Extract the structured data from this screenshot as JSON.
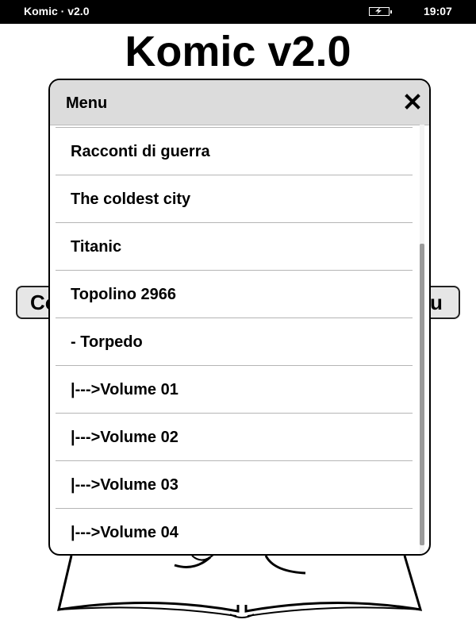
{
  "status_bar": {
    "title": "Komic · v2.0",
    "time": "19:07",
    "icons": {
      "battery": "battery-charging-icon"
    }
  },
  "app": {
    "title": "Komic v2.0"
  },
  "background_buttons": {
    "left_label": "Co",
    "right_label": "u"
  },
  "menu": {
    "title": "Menu",
    "close_icon": "close-icon",
    "items": [
      {
        "label": "Racconti di guerra"
      },
      {
        "label": "The coldest city"
      },
      {
        "label": "Titanic"
      },
      {
        "label": "Topolino 2966"
      },
      {
        "label": "- Torpedo"
      },
      {
        "label": "|--->Volume 01"
      },
      {
        "label": "|--->Volume 02"
      },
      {
        "label": "|--->Volume 03"
      },
      {
        "label": "|--->Volume 04"
      }
    ]
  },
  "colors": {
    "status_bar_bg": "#000000",
    "menu_header_bg": "#dcdcdc",
    "separator": "#b5b5b5",
    "scrollbar_thumb": "#9b9b9b"
  }
}
